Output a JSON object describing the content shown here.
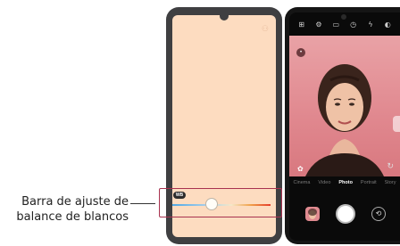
{
  "callout": {
    "line1": "Barra de ajuste de",
    "line2": "balance de blancos"
  },
  "white_balance": {
    "badge": "WB",
    "level": 0.4
  },
  "camera": {
    "modes": [
      "Cinema",
      "Video",
      "Photo",
      "Portrait",
      "Story"
    ],
    "active_mode": "Photo"
  },
  "colors": {
    "accent": "#a8324f",
    "left_screen": "#fddcc0",
    "viewfinder": "#e29097"
  }
}
